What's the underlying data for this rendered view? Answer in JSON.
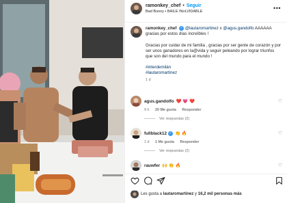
{
  "post": {
    "username": "ramonkey_chef",
    "follow_label": "Seguir",
    "music": "Bad Bunny • BAILE INoLVIDABLE",
    "more_label": "•••"
  },
  "caption": {
    "username": "ramonkey_chef",
    "mention1": "@lautaromartinez",
    "separator": " x ",
    "mention2": "@agus.gandolfo",
    "suffix": " AAAAAA gracias por estos días increíbles !",
    "body": "Gracias por cuidar de mi familia , gracias por ser gente de corazón y por ser unos ganadores en la@vida y seguir peleando por lograr triunfos que son del mundo para el mundo !",
    "hashtag1": "#interdemilán",
    "hashtag2": "#lautaromartinez",
    "time": "1 d"
  },
  "comments": [
    {
      "user": "agus.gandolfo",
      "text": "❤️ 💗 ❤️",
      "meta_time": "9 h",
      "meta_likes": "20 Me gusta",
      "meta_reply": "Responder",
      "replies": "Ver respuestas (2)"
    },
    {
      "user": "fullblack12",
      "text": "👏 🔥",
      "meta_time": "1 d",
      "meta_likes": "1 Me gusta",
      "meta_reply": "Responder",
      "replies": "Ver respuestas (2)"
    },
    {
      "user": "rauwfer",
      "text": "🙌 👏 🔥"
    }
  ],
  "likes": {
    "prefix": "Les gusta a ",
    "user": "lautaromartinez",
    "suffix": " y ",
    "count": "16,2 mil personas más"
  },
  "colors": {
    "accent": "#0095f6",
    "verified": "#3897f0",
    "mention": "#00376b",
    "heart": "#ed4956"
  }
}
